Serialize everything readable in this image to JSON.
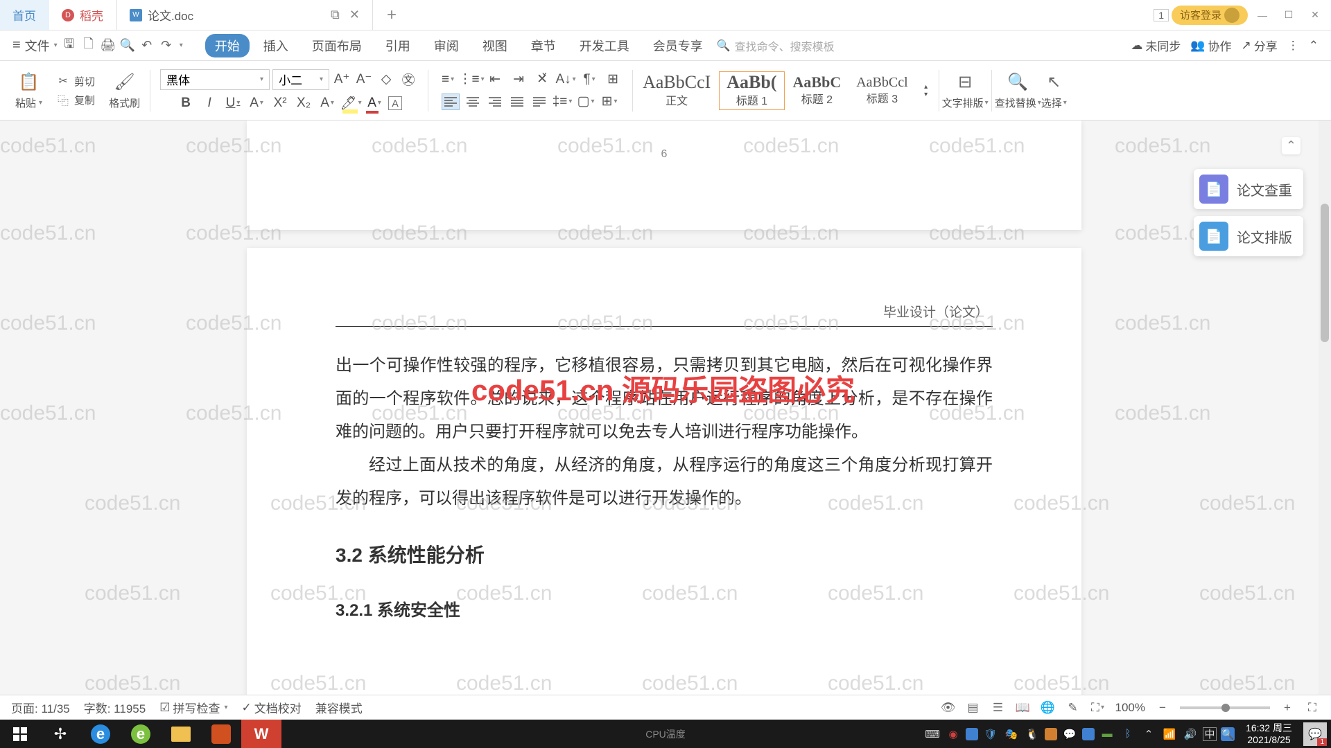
{
  "watermark_text": "code51.cn",
  "watermark_red": "code51.cn  源码乐园盗图必究",
  "tabs": {
    "home": "首页",
    "docell": "稻壳",
    "doc": "论文.doc"
  },
  "login_text": "访客登录",
  "counter": "1",
  "menus": {
    "file": "文件",
    "start": "开始",
    "insert": "插入",
    "layout": "页面布局",
    "ref": "引用",
    "review": "审阅",
    "view": "视图",
    "chapter": "章节",
    "dev": "开发工具",
    "member": "会员专享"
  },
  "search_placeholder": "查找命令、搜索模板",
  "header_right": {
    "unsync": "未同步",
    "coop": "协作",
    "share": "分享"
  },
  "ribbon": {
    "paste": "粘贴",
    "cut": "剪切",
    "copy": "复制",
    "format_brush": "格式刷",
    "font": "黑体",
    "size": "小二",
    "styles": {
      "body": "正文",
      "h1": "标题 1",
      "h2": "标题 2",
      "h3": "标题 3"
    },
    "text_layout": "文字排版",
    "find_replace": "查找替换",
    "select": "选择"
  },
  "style_previews": [
    "AaBbCcI",
    "AaBb(",
    "AaBbC",
    "AaBbCcl"
  ],
  "side": {
    "check": "论文查重",
    "layout": "论文排版"
  },
  "document": {
    "page_num_prev": "6",
    "header": "毕业设计（论文）",
    "p1": "出一个可操作性较强的程序，它移植很容易，只需拷贝到其它电脑，然后在可视化操作界面的一个程序软件。总的说来，这个程序站在用户运行程序的角度上分析，是不存在操作难的问题的。用户只要打开程序就可以免去专人培训进行程序功能操作。",
    "p2": "经过上面从技术的角度，从经济的角度，从程序运行的角度这三个角度分析现打算开发的程序，可以得出该程序软件是可以进行开发操作的。",
    "h3": "3.2 系统性能分析",
    "h4": "3.2.1  系统安全性"
  },
  "status": {
    "page": "页面: 11/35",
    "words": "字数: 11955",
    "spell": "拼写检查",
    "proof": "文档校对",
    "compat": "兼容模式",
    "zoom": "100%"
  },
  "taskbar": {
    "time": "16:32 周三",
    "date": "2021/8/25",
    "ime": "中",
    "notif_count": "1",
    "temp_label": "CPU温度"
  }
}
